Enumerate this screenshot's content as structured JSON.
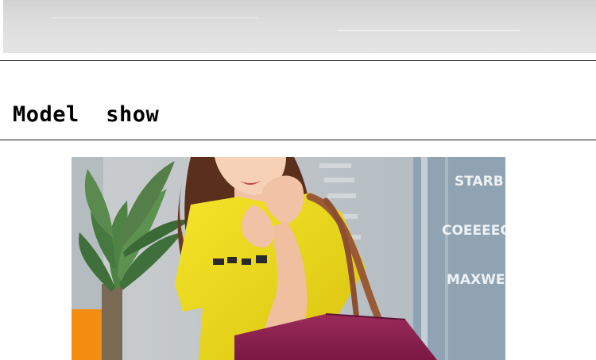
{
  "section": {
    "title": "Model  show"
  },
  "photo": {
    "storefront_signs": [
      "STARB",
      "COEEEEC",
      "MAXWE"
    ]
  },
  "colors": {
    "shirt": "#f1df1e",
    "bag": "#8a1f4e",
    "strap": "#9a5a36",
    "rule": "#1a1a1a"
  }
}
